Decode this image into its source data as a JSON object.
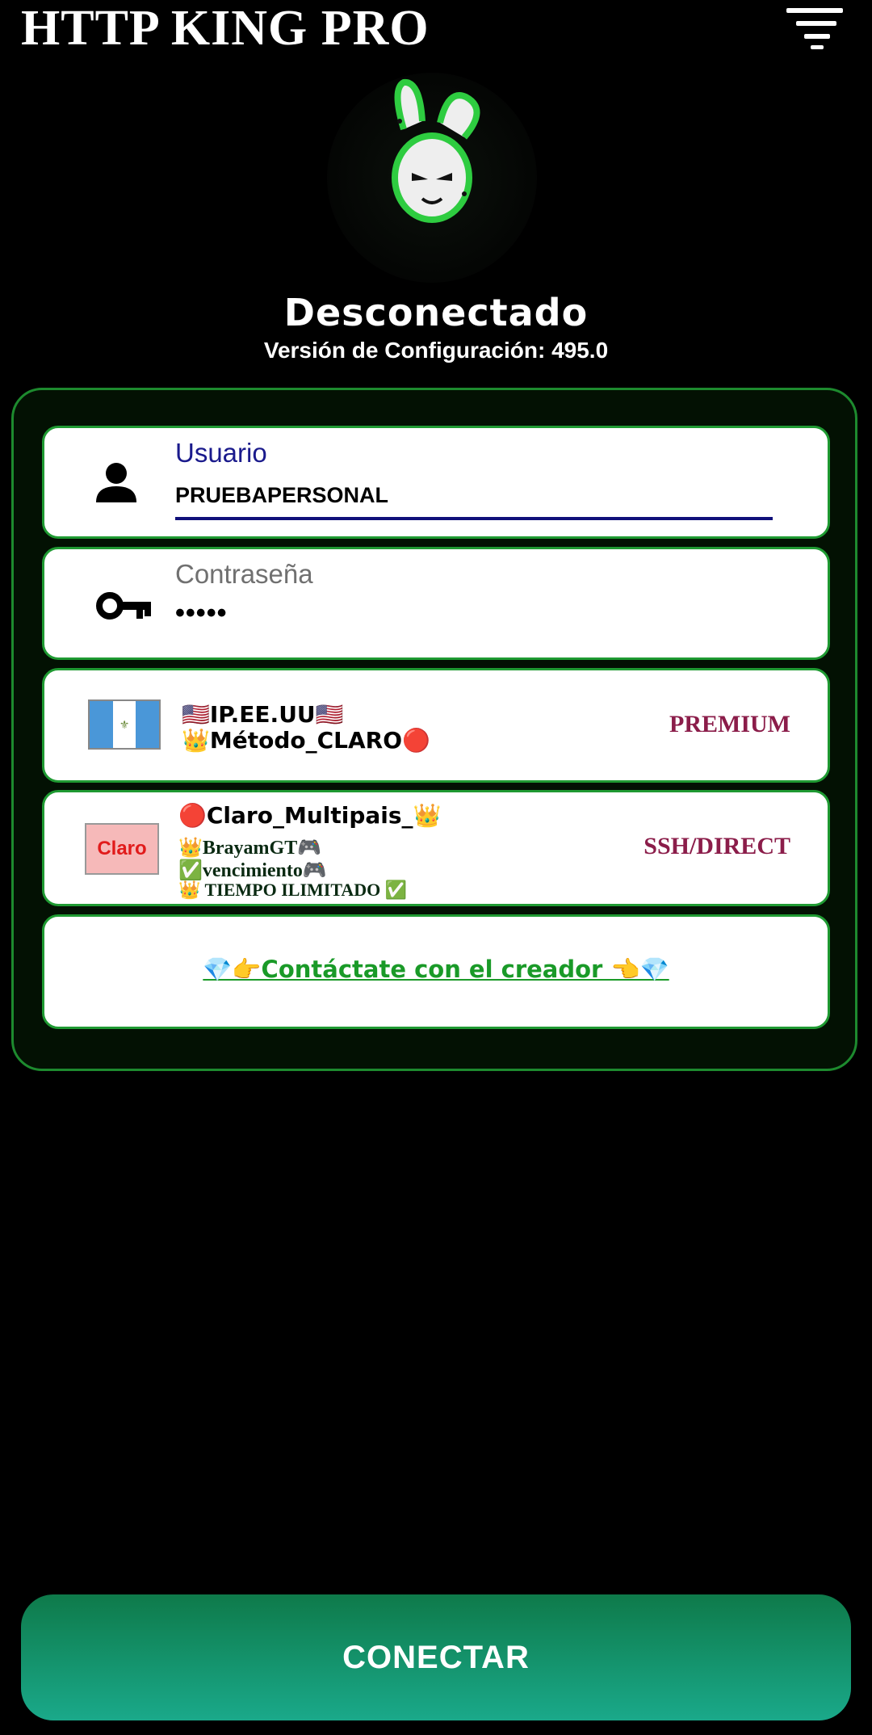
{
  "app": {
    "title": "HTTP KING PRO"
  },
  "status": {
    "text": "Desconectado",
    "version": "Versión de Configuración: 495.0"
  },
  "form": {
    "user": {
      "label": "Usuario",
      "value": "PRUEBAPERSONAL"
    },
    "password": {
      "label": "Contraseña",
      "value": "•••••"
    }
  },
  "server": {
    "line1": "🇺🇸IP.EE.UU🇺🇸",
    "line2": "👑Método_CLARO🔴",
    "tag": "PREMIUM"
  },
  "payload": {
    "logo_text": "Claro",
    "line1": "🔴Claro_Multipais_👑",
    "line2": "👑BrayamGT🎮",
    "line3": "✅vencimiento🎮",
    "line4": "👑 TIEMPO ILIMITADO ✅",
    "tag": "SSH/DIRECT"
  },
  "contact": {
    "label": "💎👉Contáctate con el creador 👈💎"
  },
  "connect": {
    "label": "CONECTAR"
  },
  "icons": [
    "menu-icon",
    "bunny-logo",
    "person-icon",
    "key-icon",
    "guatemala-flag-icon",
    "claro-logo"
  ],
  "colors": {
    "accent_green": "#1f9a32",
    "tag_color": "#8b1d4a",
    "button_gradient": [
      "#0e7a4a",
      "#1aa98a"
    ]
  }
}
